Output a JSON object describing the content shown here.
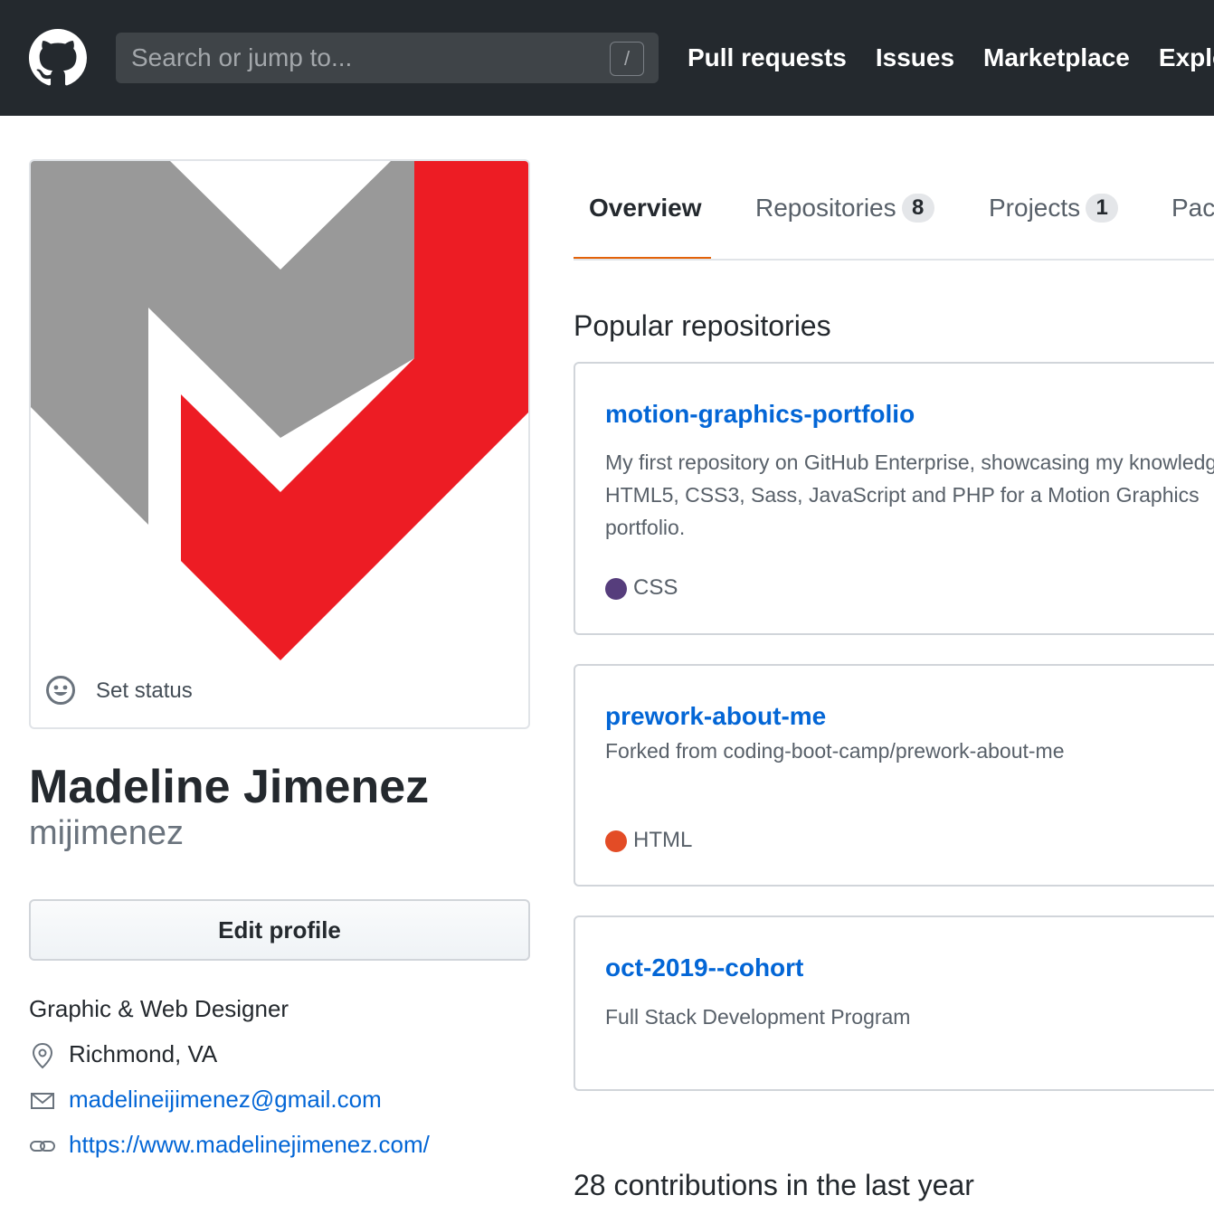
{
  "header": {
    "search_placeholder": "Search or jump to...",
    "search_shortcut": "/",
    "nav": [
      "Pull requests",
      "Issues",
      "Marketplace",
      "Explore"
    ]
  },
  "profile": {
    "set_status": "Set status",
    "fullname": "Madeline Jimenez",
    "username": "mijimenez",
    "edit_button": "Edit profile",
    "bio": "Graphic & Web Designer",
    "location": "Richmond, VA",
    "email": "madelineijimenez@gmail.com",
    "website": "https://www.madelinejimenez.com/"
  },
  "tabs": [
    {
      "label": "Overview",
      "count": null,
      "selected": true
    },
    {
      "label": "Repositories",
      "count": "8",
      "selected": false
    },
    {
      "label": "Projects",
      "count": "1",
      "selected": false
    },
    {
      "label": "Packages",
      "count": null,
      "selected": false
    }
  ],
  "popular": {
    "title": "Popular repositories",
    "repos": [
      {
        "name": "motion-graphics-portfolio",
        "description_lines": [
          "My first repository on GitHub Enterprise, showcasing my knowledge of",
          "HTML5, CSS3, Sass, JavaScript and PHP for a Motion Graphics",
          "portfolio."
        ],
        "language": "CSS",
        "language_color": "#563d7c"
      },
      {
        "name": "prework-about-me",
        "description_lines": [
          "Forked from coding-boot-camp/prework-about-me"
        ],
        "language": "HTML",
        "language_color": "#e34c26"
      },
      {
        "name": "oct-2019--cohort",
        "description_lines": [
          "Full Stack Development Program"
        ],
        "language": null,
        "language_color": null
      }
    ]
  },
  "contributions": {
    "title": "28 contributions in the last year"
  },
  "colors": {
    "header_bg": "#24292e",
    "link": "#0366d6",
    "tab_accent": "#e36209",
    "logo_red": "#ed1c24",
    "logo_gray": "#999999"
  }
}
